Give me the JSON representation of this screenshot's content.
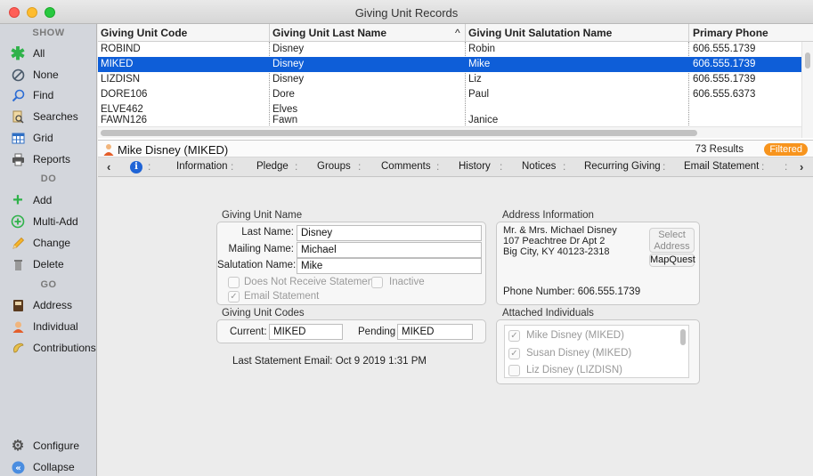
{
  "window": {
    "title": "Giving Unit Records"
  },
  "sidebar": {
    "show_heading": "SHOW",
    "do_heading": "DO",
    "go_heading": "GO",
    "show_items": [
      {
        "label": "All",
        "icon": "asterisk-icon"
      },
      {
        "label": "None",
        "icon": "no-entry-icon"
      },
      {
        "label": "Find",
        "icon": "magnifier-icon"
      },
      {
        "label": "Searches",
        "icon": "saved-search-icon"
      },
      {
        "label": "Grid",
        "icon": "grid-icon"
      },
      {
        "label": "Reports",
        "icon": "printer-icon"
      }
    ],
    "do_items": [
      {
        "label": "Add",
        "icon": "plus-icon"
      },
      {
        "label": "Multi-Add",
        "icon": "multi-add-icon"
      },
      {
        "label": "Change",
        "icon": "pencil-icon"
      },
      {
        "label": "Delete",
        "icon": "trash-icon"
      }
    ],
    "go_items": [
      {
        "label": "Address",
        "icon": "address-book-icon"
      },
      {
        "label": "Individual",
        "icon": "person-icon"
      },
      {
        "label": "Contributions",
        "icon": "contribution-icon"
      }
    ],
    "bottom_items": [
      {
        "label": "Configure",
        "icon": "gear-icon"
      },
      {
        "label": "Collapse",
        "icon": "collapse-icon"
      }
    ]
  },
  "records": {
    "columns": [
      "Giving Unit Code",
      "Giving Unit Last Name",
      "Giving Unit Salutation Name",
      "Primary Phone"
    ],
    "sort_indicator": "^",
    "rows": [
      {
        "code": "ROBIND",
        "last": "Disney",
        "salutation": "Robin",
        "phone": "606.555.1739",
        "selected": false
      },
      {
        "code": "MIKED",
        "last": "Disney",
        "salutation": "Mike",
        "phone": "606.555.1739",
        "selected": true
      },
      {
        "code": "LIZDISN",
        "last": "Disney",
        "salutation": "Liz",
        "phone": "606.555.1739",
        "selected": false
      },
      {
        "code": "DORE106",
        "last": "Dore",
        "salutation": "Paul",
        "phone": "606.555.6373",
        "selected": false
      },
      {
        "code": "ELVE462",
        "last": "Elves",
        "salutation": "",
        "phone": "",
        "selected": false
      },
      {
        "code": "FAWN126",
        "last": "Fawn",
        "salutation": "Janice",
        "phone": "",
        "selected": false
      }
    ]
  },
  "person": {
    "name": "Mike Disney (MIKED)",
    "results": "73 Results",
    "filter_badge": "Filtered"
  },
  "tabs": {
    "prev": "‹",
    "next": "›",
    "info_glyph": "i",
    "sep": ":",
    "items": [
      "Information",
      "Pledge",
      "Groups",
      "Comments",
      "History",
      "Notices",
      "Recurring Giving",
      "Email Statement"
    ],
    "active": "Information"
  },
  "giving_unit_name": {
    "title": "Giving Unit Name",
    "last_name_label": "Last Name:",
    "last_name": "Disney",
    "mailing_name_label": "Mailing Name:",
    "mailing_name": "Michael",
    "salutation_label": "Salutation Name:",
    "salutation": "Mike",
    "no_statement_label": "Does Not Receive Statement",
    "no_statement_checked": false,
    "inactive_label": "Inactive",
    "inactive_checked": false,
    "email_statement_label": "Email Statement",
    "email_statement_checked": true
  },
  "giving_unit_codes": {
    "title": "Giving Unit Codes",
    "current_label": "Current:",
    "current": "MIKED",
    "pending_label": "Pending",
    "pending": "MIKED"
  },
  "last_statement": "Last Statement Email:  Oct 9 2019 1:31 PM",
  "address": {
    "title": "Address Information",
    "lines": [
      "Mr. & Mrs. Michael Disney",
      "107 Peachtree Dr  Apt 2",
      "Big City, KY 40123-2318"
    ],
    "select_button": "Select Address",
    "mapquest_button": "MapQuest",
    "phone": "Phone Number:  606.555.1739"
  },
  "attached": {
    "title": "Attached Individuals",
    "items": [
      {
        "label": "Mike Disney (MIKED)",
        "checked": true
      },
      {
        "label": "Susan Disney (MIKED)",
        "checked": true
      },
      {
        "label": "Liz Disney (LIZDISN)",
        "checked": false
      }
    ]
  },
  "colors": {
    "selection": "#0e5ed8",
    "filter_badge": "#f7941d",
    "sidebar": "#d3d6dc"
  }
}
